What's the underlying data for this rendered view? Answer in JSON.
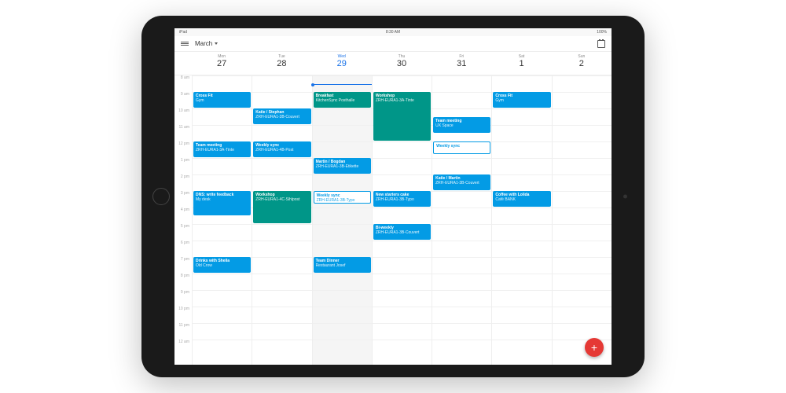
{
  "statusBar": {
    "device": "iPad",
    "time": "8:30 AM",
    "battery": "100%"
  },
  "header": {
    "month": "March"
  },
  "days": [
    {
      "dow": "Mon",
      "num": "27",
      "today": false
    },
    {
      "dow": "Tue",
      "num": "28",
      "today": false
    },
    {
      "dow": "Wed",
      "num": "29",
      "today": true
    },
    {
      "dow": "Thu",
      "num": "30",
      "today": false
    },
    {
      "dow": "Fri",
      "num": "31",
      "today": false
    },
    {
      "dow": "Sat",
      "num": "1",
      "today": false
    },
    {
      "dow": "Sun",
      "num": "2",
      "today": false
    }
  ],
  "hours": [
    "8 am",
    "9 am",
    "10 am",
    "11 am",
    "12 pm",
    "1 pm",
    "2 pm",
    "3 pm",
    "4 pm",
    "5 pm",
    "6 pm",
    "7 pm",
    "8 pm",
    "9 pm",
    "10 pm",
    "11 pm",
    "12 am"
  ],
  "hourHeight": 21,
  "startHour": 8,
  "nowHour": 8.5,
  "events": [
    {
      "day": 0,
      "start": 9,
      "end": 10,
      "title": "Cross Fit",
      "sub": "Gym",
      "style": "blue"
    },
    {
      "day": 0,
      "start": 12,
      "end": 13,
      "title": "Team meeting",
      "sub": "ZRH-EURA1-3A-Tinte",
      "style": "blue"
    },
    {
      "day": 0,
      "start": 15,
      "end": 16.5,
      "title": "DNS: write feedback",
      "sub": "My desk",
      "style": "blue"
    },
    {
      "day": 0,
      "start": 19,
      "end": 20,
      "title": "Drinks with Sheila",
      "sub": "Old Crow",
      "style": "blue"
    },
    {
      "day": 1,
      "start": 10,
      "end": 11,
      "title": "Katie / Stephan",
      "sub": "ZRH-EURA1-3B-Couvert",
      "style": "blue"
    },
    {
      "day": 1,
      "start": 12,
      "end": 13,
      "title": "Weekly sync",
      "sub": "ZRH-EURA1-4B-Post",
      "style": "blue"
    },
    {
      "day": 1,
      "start": 15,
      "end": 17,
      "title": "Workshop",
      "sub": "ZRH-EURA1-4C-Sihlpost",
      "style": "teal"
    },
    {
      "day": 2,
      "start": 9,
      "end": 10,
      "title": "Breakfast",
      "sub": "KitchenSync Posthalle",
      "style": "teal"
    },
    {
      "day": 2,
      "start": 13,
      "end": 14,
      "title": "Martin / Bogdan",
      "sub": "ZRH-EURA1-3B-Etikette",
      "style": "blue"
    },
    {
      "day": 2,
      "start": 15,
      "end": 15.8,
      "title": "Weekly sync",
      "sub": "ZRH-EURA1-3B-Typo",
      "style": "outline"
    },
    {
      "day": 2,
      "start": 19,
      "end": 20,
      "title": "Team Dinner",
      "sub": "Restaurant Josef",
      "style": "blue"
    },
    {
      "day": 3,
      "start": 9,
      "end": 12,
      "title": "Workshop",
      "sub": "ZRH-EURA1-3A-Tinte",
      "style": "teal"
    },
    {
      "day": 3,
      "start": 15,
      "end": 16,
      "title": "New starters cake",
      "sub": "ZRH-EURA1-3B-Typo",
      "style": "blue"
    },
    {
      "day": 3,
      "start": 17,
      "end": 18,
      "title": "Bi-weekly",
      "sub": "ZRH-EURA1-3B-Couvert",
      "style": "blue"
    },
    {
      "day": 4,
      "start": 10.5,
      "end": 11.5,
      "title": "Team meeting",
      "sub": "UX Space",
      "style": "blue"
    },
    {
      "day": 4,
      "start": 12,
      "end": 12.8,
      "title": "Weekly sync",
      "sub": "",
      "style": "outline"
    },
    {
      "day": 4,
      "start": 14,
      "end": 15,
      "title": "Katie / Martin",
      "sub": "ZRH-EURA1-3B-Couvert",
      "style": "blue"
    },
    {
      "day": 5,
      "start": 9,
      "end": 10,
      "title": "Cross Fit",
      "sub": "Gym",
      "style": "blue"
    },
    {
      "day": 5,
      "start": 15,
      "end": 16,
      "title": "Coffee with Lolida",
      "sub": "Café BANK",
      "style": "blue"
    }
  ],
  "fab": {
    "label": "+"
  }
}
